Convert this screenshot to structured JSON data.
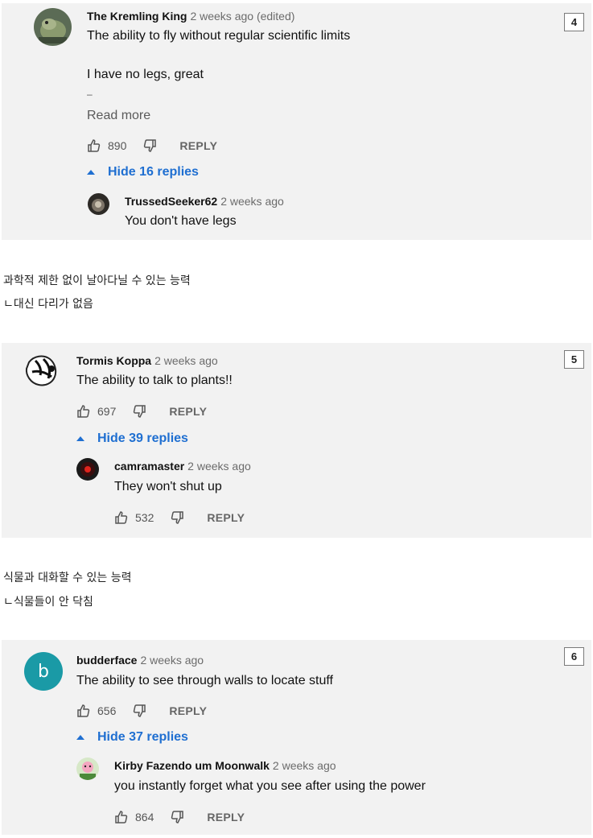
{
  "comments": [
    {
      "badge": "4",
      "author": "The Kremling King",
      "time": "2 weeks ago (edited)",
      "line1": "The ability to fly without regular scientific limits",
      "line2": "I have no legs, great",
      "line3": "–",
      "read_more": "Read more",
      "likes": "890",
      "reply_label": "REPLY",
      "toggle_label": "Hide 16 replies",
      "reply": {
        "author": "TrussedSeeker62",
        "time": "2 weeks ago",
        "text": "You don't have legs"
      }
    },
    {
      "badge": "5",
      "author": "Tormis Koppa",
      "time": "2 weeks ago",
      "text": "The ability to talk to plants!!",
      "likes": "697",
      "reply_label": "REPLY",
      "toggle_label": "Hide 39 replies",
      "reply": {
        "author": "camramaster",
        "time": "2 weeks ago",
        "text": "They won't shut up",
        "likes": "532",
        "reply_label": "REPLY"
      }
    },
    {
      "badge": "6",
      "author": "budderface",
      "avatar_letter": "b",
      "time": "2 weeks ago",
      "text": "The ability to see through walls to locate stuff",
      "likes": "656",
      "reply_label": "REPLY",
      "toggle_label": "Hide 37 replies",
      "reply": {
        "author": "Kirby Fazendo um Moonwalk",
        "time": "2 weeks ago",
        "text": "you instantly forget what you see after using the power",
        "likes": "864",
        "reply_label": "REPLY"
      }
    }
  ],
  "captions": [
    {
      "line1": "과학적 제한 없이 날아다닐 수 있는 능력",
      "line2": "ㄴ대신 다리가 없음"
    },
    {
      "line1": "식물과 대화할 수 있는 능력",
      "line2": "ㄴ식물들이 안 닥침"
    }
  ],
  "colors": {
    "card_bg": "#f2f2f2",
    "link_blue": "#1f6fd1",
    "avatar_b": "#1a9aa6"
  },
  "icons": [
    "thumbs-up-icon",
    "thumbs-down-icon",
    "collapse-triangle-icon"
  ]
}
